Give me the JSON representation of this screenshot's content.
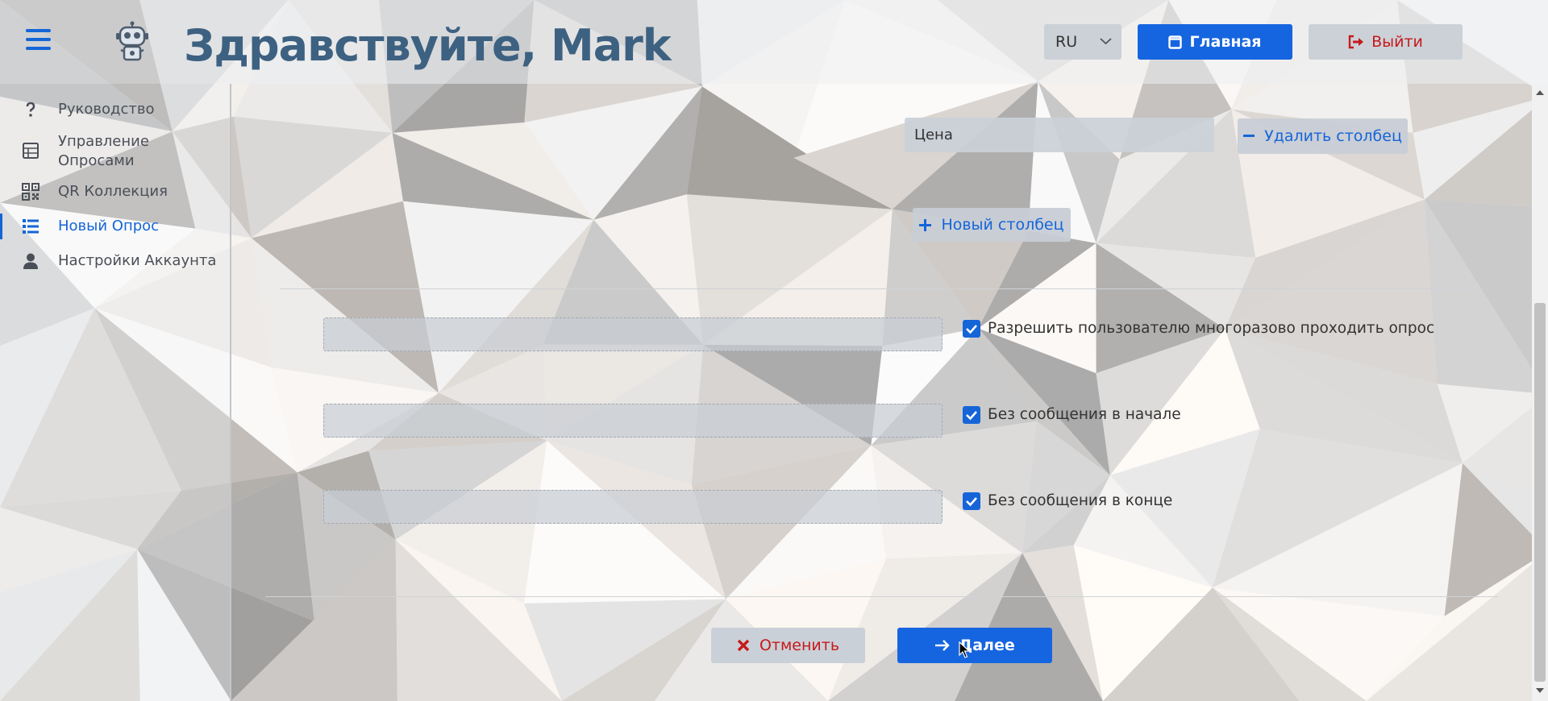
{
  "header": {
    "greeting": "Здравствуйте, Mark",
    "language": "RU",
    "home_label": "Главная",
    "logout_label": "Выйти"
  },
  "sidebar": {
    "items": [
      {
        "label": "Руководство",
        "icon": "question-icon"
      },
      {
        "label": "Управление Опросами",
        "icon": "survey-management-icon"
      },
      {
        "label": "QR Коллекция",
        "icon": "qr-code-icon"
      },
      {
        "label": "Новый Опрос",
        "icon": "list-icon",
        "active": true
      },
      {
        "label": "Настройки Аккаунта",
        "icon": "user-icon"
      }
    ]
  },
  "main": {
    "column_value": "Цена",
    "remove_column_label": "Удалить столбец",
    "new_column_label": "Новый столбец",
    "options": [
      {
        "label": "Разрешить пользователю многоразово проходить опрос",
        "checked": true
      },
      {
        "label": "Без сообщения в начале",
        "checked": true
      },
      {
        "label": "Без сообщения в конце",
        "checked": true
      }
    ],
    "cancel_label": "Отменить",
    "next_label": "Далее"
  },
  "colors": {
    "accent": "#1665e0",
    "danger": "#c61a1a",
    "title": "#3d6181"
  }
}
